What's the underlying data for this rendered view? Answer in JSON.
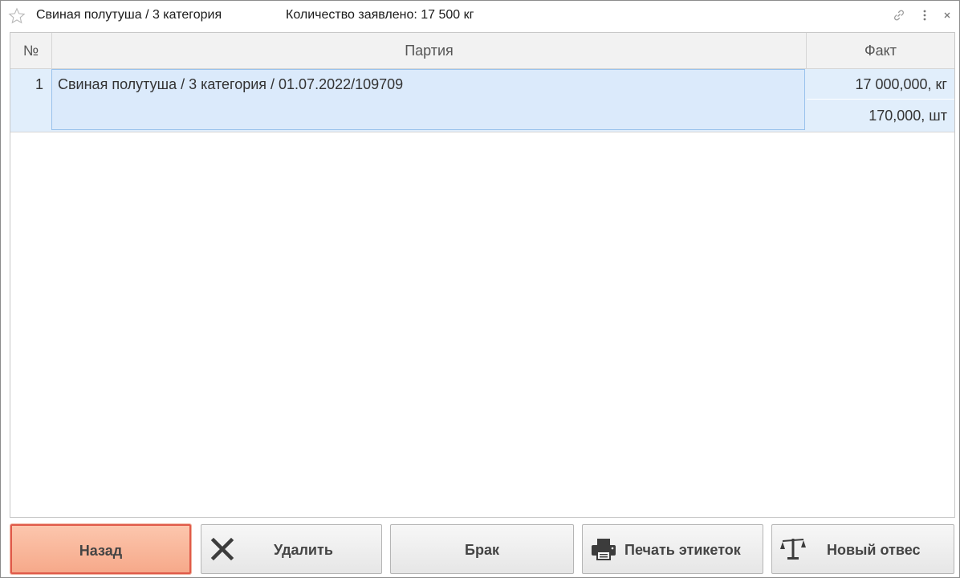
{
  "window": {
    "title": "Свиная полутуша / 3 категория",
    "declared_quantity": "Количество заявлено: 17 500 кг"
  },
  "table": {
    "columns": [
      "№",
      "Партия",
      "Факт"
    ],
    "rows": [
      {
        "number": "1",
        "party": "Свиная полутуша / 3 категория / 01.07.2022/109709",
        "fact_weight": "17 000,000, кг",
        "fact_pieces": "170,000, шт"
      }
    ]
  },
  "buttons": {
    "back": "Назад",
    "delete": "Удалить",
    "defect": "Брак",
    "print_labels": "Печать этикеток",
    "new_weighing": "Новый отвес"
  },
  "icons": {
    "favorite": "star-icon",
    "link": "link-icon",
    "more": "more-icon",
    "close": "close-icon",
    "delete": "x-icon",
    "print": "printer-icon",
    "weigh": "scales-icon"
  },
  "colors": {
    "accent_button": "#f6a98a",
    "accent_border": "#e05a4a",
    "selection": "#dbeafb"
  }
}
